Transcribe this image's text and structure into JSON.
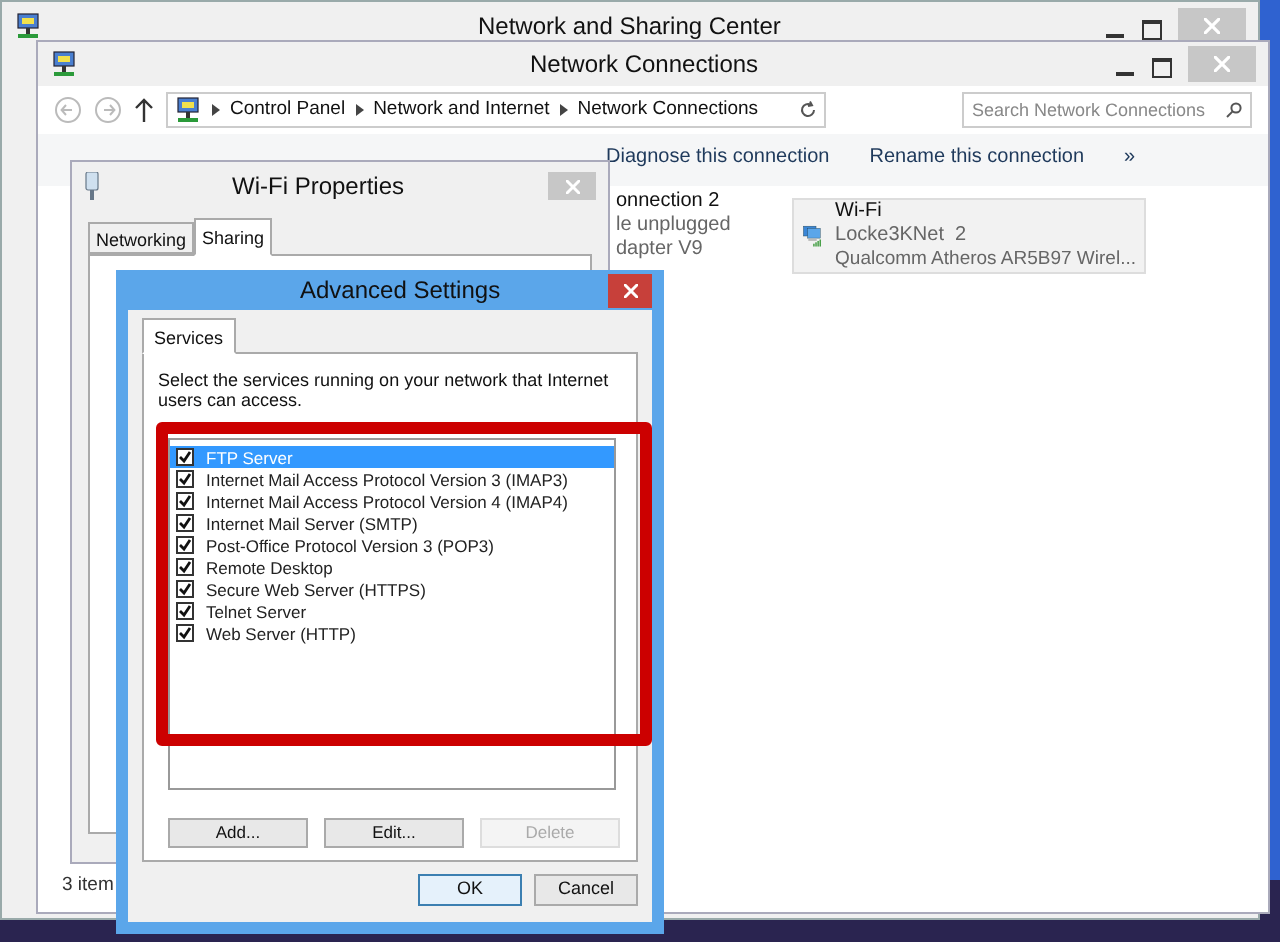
{
  "background_window": {
    "title": "Network and Sharing Center"
  },
  "explorer": {
    "title": "Network Connections",
    "breadcrumb": [
      "Control Panel",
      "Network and Internet",
      "Network Connections"
    ],
    "search": {
      "placeholder": "Search Network Connections"
    },
    "toolbar": [
      "Diagnose this connection",
      "Rename this connection",
      "»"
    ],
    "connections": [
      {
        "kind": "partial",
        "lines": [
          "onnection 2",
          "le unplugged",
          "dapter V9"
        ]
      },
      {
        "kind": "wifi",
        "name": "Wi-Fi",
        "network": "Locke3KNet  2",
        "adapter": "Qualcomm Atheros AR5B97 Wirel..."
      }
    ],
    "status": "3 item"
  },
  "properties": {
    "title": "Wi-Fi Properties",
    "tabs": [
      {
        "label": "Networking",
        "selected": false
      },
      {
        "label": "Sharing",
        "selected": true
      }
    ]
  },
  "advanced": {
    "title": "Advanced Settings",
    "tabs": [
      {
        "label": "Services",
        "selected": true
      }
    ],
    "description": "Select the services running on your network that Internet users can access.",
    "services": [
      {
        "label": "FTP Server",
        "checked": true,
        "selected": true
      },
      {
        "label": "Internet Mail Access Protocol Version 3 (IMAP3)",
        "checked": true,
        "selected": false
      },
      {
        "label": "Internet Mail Access Protocol Version 4 (IMAP4)",
        "checked": true,
        "selected": false
      },
      {
        "label": "Internet Mail Server (SMTP)",
        "checked": true,
        "selected": false
      },
      {
        "label": "Post-Office Protocol Version 3 (POP3)",
        "checked": true,
        "selected": false
      },
      {
        "label": "Remote Desktop",
        "checked": true,
        "selected": false
      },
      {
        "label": "Secure Web Server (HTTPS)",
        "checked": true,
        "selected": false
      },
      {
        "label": "Telnet Server",
        "checked": true,
        "selected": false
      },
      {
        "label": "Web Server (HTTP)",
        "checked": true,
        "selected": false
      }
    ],
    "buttons": [
      {
        "label": "Add...",
        "disabled": false
      },
      {
        "label": "Edit...",
        "disabled": false
      },
      {
        "label": "Delete",
        "disabled": true
      }
    ],
    "dialog_buttons": [
      {
        "label": "OK",
        "default": true
      },
      {
        "label": "Cancel",
        "default": false
      }
    ]
  }
}
